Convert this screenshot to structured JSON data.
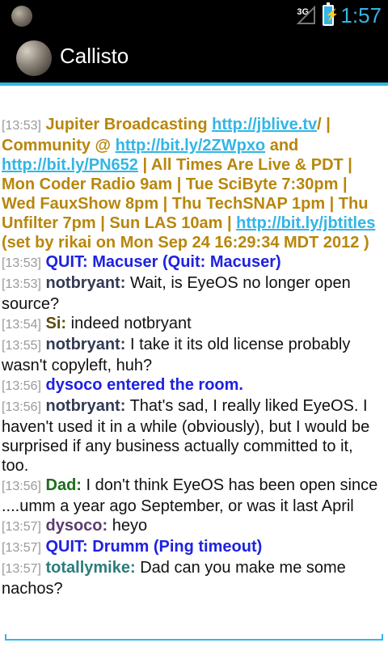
{
  "status": {
    "network": "3G",
    "time": "1:57"
  },
  "app": {
    "title": "Callisto"
  },
  "messages": [
    {
      "time": "[13:53]",
      "topic_parts": [
        {
          "text": "Jupiter Broadcasting ",
          "link": false
        },
        {
          "text": "http://jblive.tv",
          "link": true
        },
        {
          "text": "/ | Community @ ",
          "link": false
        },
        {
          "text": "http://bit.ly/2ZWpxo",
          "link": true
        },
        {
          "text": " and ",
          "link": false
        },
        {
          "text": "http://bit.ly/PN652",
          "link": true
        },
        {
          "text": " | All Times Are Live & PDT | Mon Coder Radio 9am | Tue SciByte 7:30pm | Wed FauxShow 8pm | Thu TechSNAP 1pm | Thu Unfilter 7pm | Sun LAS 10am | ",
          "link": false
        },
        {
          "text": "http://bit.ly/jbtitles",
          "link": true
        },
        {
          "text": " (set by rikai on Mon Sep 24 16:29:34 MDT 2012 )",
          "link": false
        }
      ]
    },
    {
      "time": "[13:53]",
      "system": "QUIT:  Macuser (Quit: Macuser)"
    },
    {
      "time": "[13:53]",
      "nick": "notbryant:",
      "nick_class": "nick-notbryant",
      "text": "Wait, is EyeOS no longer open source?"
    },
    {
      "time": "[13:54]",
      "nick": "Si:",
      "nick_class": "nick-si",
      "text": "indeed notbryant"
    },
    {
      "time": "[13:55]",
      "nick": "notbryant:",
      "nick_class": "nick-notbryant",
      "text": "I take it its old license probably wasn't copyleft, huh?"
    },
    {
      "time": "[13:56]",
      "system": "dysoco entered the room."
    },
    {
      "time": "[13:56]",
      "nick": "notbryant:",
      "nick_class": "nick-notbryant",
      "text": "That's sad, I really liked EyeOS. I haven't used it in a while (obviously), but I would be surprised if any business actually committed to it, too."
    },
    {
      "time": "[13:56]",
      "nick": "Dad:",
      "nick_class": "nick-dad",
      "text": "I don't think EyeOS has been open since ....umm a year ago September,  or was it last April"
    },
    {
      "time": "[13:57]",
      "nick": "dysoco:",
      "nick_class": "nick-dysoco",
      "text": "heyo"
    },
    {
      "time": "[13:57]",
      "system": "QUIT:  Drumm (Ping timeout)"
    },
    {
      "time": "[13:57]",
      "nick": "totallymike:",
      "nick_class": "nick-totallymike",
      "text": "Dad can you make me some nachos?"
    }
  ]
}
